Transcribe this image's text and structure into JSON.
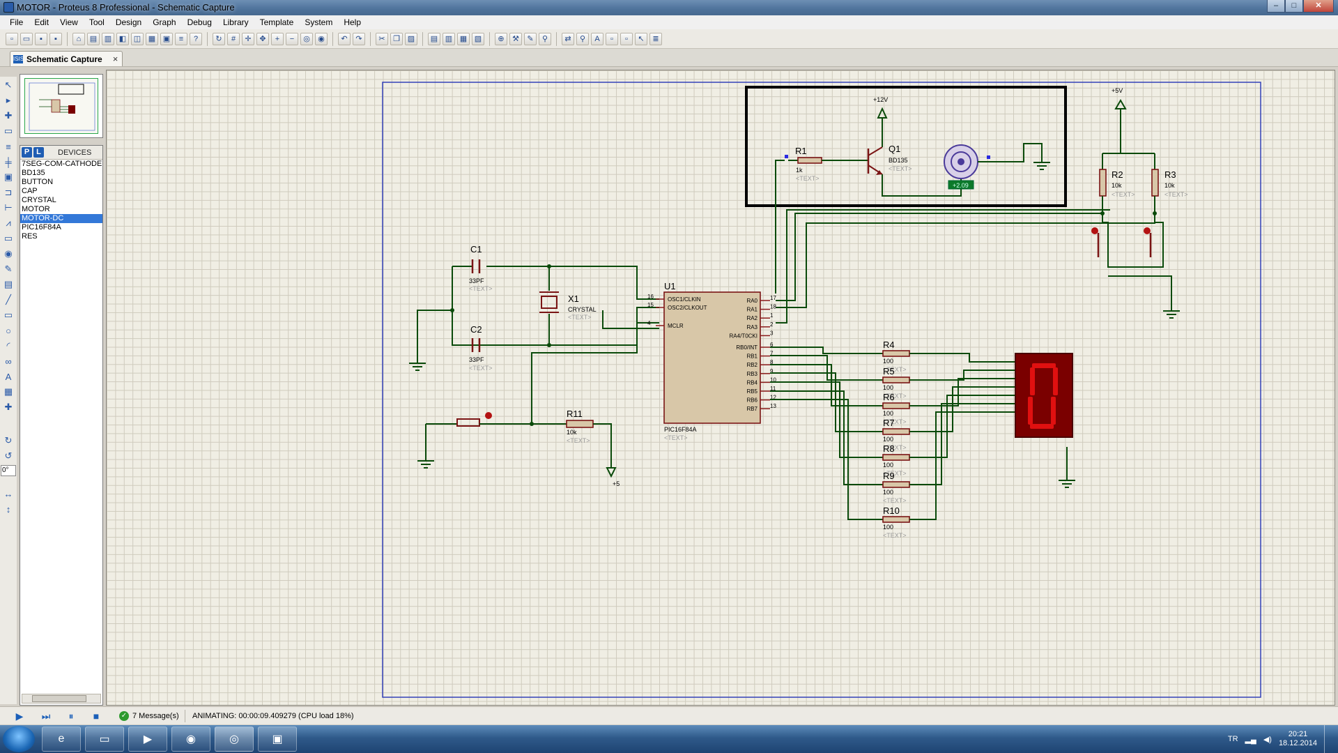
{
  "window": {
    "title": "MOTOR - Proteus 8 Professional - Schematic Capture",
    "min": "‒",
    "max": "□",
    "close": "✕"
  },
  "menu": [
    "File",
    "Edit",
    "View",
    "Tool",
    "Design",
    "Graph",
    "Debug",
    "Library",
    "Template",
    "System",
    "Help"
  ],
  "tab": {
    "icon": "ISIS",
    "label": "Schematic Capture",
    "close": "×"
  },
  "devices": {
    "p_button": "P",
    "l_button": "L",
    "header": "DEVICES",
    "items": [
      "7SEG-COM-CATHODE",
      "BD135",
      "BUTTON",
      "CAP",
      "CRYSTAL",
      "MOTOR",
      "MOTOR-DC",
      "PIC16F84A",
      "RES"
    ],
    "selected_index": 6
  },
  "rotation_value": "0°",
  "schematic": {
    "power": {
      "v12": "+12V",
      "v5_top": "+5V",
      "v5_bottom": "+5"
    },
    "r1": {
      "ref": "R1",
      "value": "1k",
      "text": "<TEXT>"
    },
    "q1": {
      "ref": "Q1",
      "value": "BD135",
      "text": "<TEXT>"
    },
    "motor": {
      "readout": "+2.09"
    },
    "r2": {
      "ref": "R2",
      "value": "10k",
      "text": "<TEXT>"
    },
    "r3": {
      "ref": "R3",
      "value": "10k",
      "text": "<TEXT>"
    },
    "c1": {
      "ref": "C1",
      "value": "33PF",
      "text": "<TEXT>"
    },
    "c2": {
      "ref": "C2",
      "value": "33PF",
      "text": "<TEXT>"
    },
    "x1": {
      "ref": "X1",
      "value": "CRYSTAL",
      "text": "<TEXT>"
    },
    "r11": {
      "ref": "R11",
      "value": "10k",
      "text": "<TEXT>"
    },
    "u1": {
      "ref": "U1",
      "part": "PIC16F84A",
      "text": "<TEXT>",
      "left_pins": [
        {
          "num": "16",
          "name": "OSC1/CLKIN"
        },
        {
          "num": "15",
          "name": "OSC2/CLKOUT"
        },
        {
          "num": "4",
          "name": "MCLR"
        }
      ],
      "right_pins": [
        {
          "num": "17",
          "name": "RA0"
        },
        {
          "num": "18",
          "name": "RA1"
        },
        {
          "num": "1",
          "name": "RA2"
        },
        {
          "num": "2",
          "name": "RA3"
        },
        {
          "num": "3",
          "name": "RA4/T0CKI"
        },
        {
          "num": "6",
          "name": "RB0/INT"
        },
        {
          "num": "7",
          "name": "RB1"
        },
        {
          "num": "8",
          "name": "RB2"
        },
        {
          "num": "9",
          "name": "RB3"
        },
        {
          "num": "10",
          "name": "RB4"
        },
        {
          "num": "11",
          "name": "RB5"
        },
        {
          "num": "12",
          "name": "RB6"
        },
        {
          "num": "13",
          "name": "RB7"
        }
      ]
    },
    "seg_resistors": [
      {
        "ref": "R4",
        "value": "100",
        "text": "<TEXT>"
      },
      {
        "ref": "R5",
        "value": "100",
        "text": "<TEXT>"
      },
      {
        "ref": "R6",
        "value": "100",
        "text": "<TEXT>"
      },
      {
        "ref": "R7",
        "value": "100",
        "text": "<TEXT>"
      },
      {
        "ref": "R8",
        "value": "100",
        "text": "<TEXT>"
      },
      {
        "ref": "R9",
        "value": "100",
        "text": "<TEXT>"
      },
      {
        "ref": "R10",
        "value": "100",
        "text": "<TEXT>"
      }
    ],
    "display_digit": "0"
  },
  "status": {
    "messages": "7 Message(s)",
    "animation": "ANIMATING: 00:00:09.409279 (CPU load 18%)"
  },
  "taskbar": {
    "lang": "TR",
    "time": "20:21",
    "date": "18.12.2014"
  },
  "colors": {
    "wire": "#0a4a0a",
    "component_outline": "#7a1414",
    "component_fill": "#d8c7a8",
    "segment_on": "#e01010",
    "display_body": "#7a0000",
    "selection": "#3378d8"
  }
}
